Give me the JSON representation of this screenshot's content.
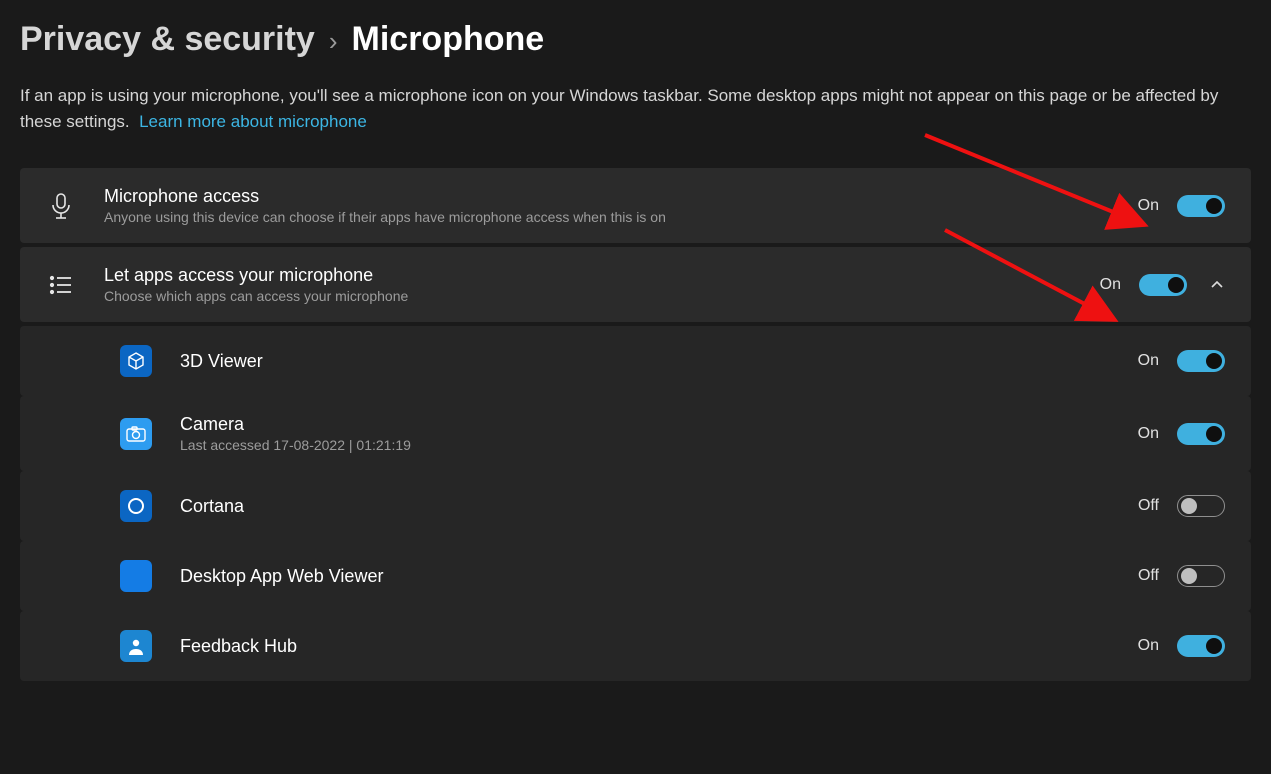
{
  "breadcrumb": {
    "parent": "Privacy & security",
    "current": "Microphone"
  },
  "intro": {
    "text": "If an app is using your microphone, you'll see a microphone icon on your Windows taskbar. Some desktop apps might not appear on this page or be affected by these settings.",
    "link": "Learn more about microphone"
  },
  "settings": {
    "mic_access": {
      "title": "Microphone access",
      "subtitle": "Anyone using this device can choose if their apps have microphone access when this is on",
      "status": "On",
      "on": true
    },
    "let_apps": {
      "title": "Let apps access your microphone",
      "subtitle": "Choose which apps can access your microphone",
      "status": "On",
      "on": true
    }
  },
  "apps": [
    {
      "name": "3D Viewer",
      "subtitle": "",
      "status": "On",
      "on": true,
      "icon": "cube"
    },
    {
      "name": "Camera",
      "subtitle": "Last accessed 17-08-2022  |  01:21:19",
      "status": "On",
      "on": true,
      "icon": "camera"
    },
    {
      "name": "Cortana",
      "subtitle": "",
      "status": "Off",
      "on": false,
      "icon": "ring"
    },
    {
      "name": "Desktop App Web Viewer",
      "subtitle": "",
      "status": "Off",
      "on": false,
      "icon": "solid"
    },
    {
      "name": "Feedback Hub",
      "subtitle": "",
      "status": "On",
      "on": true,
      "icon": "person"
    }
  ]
}
